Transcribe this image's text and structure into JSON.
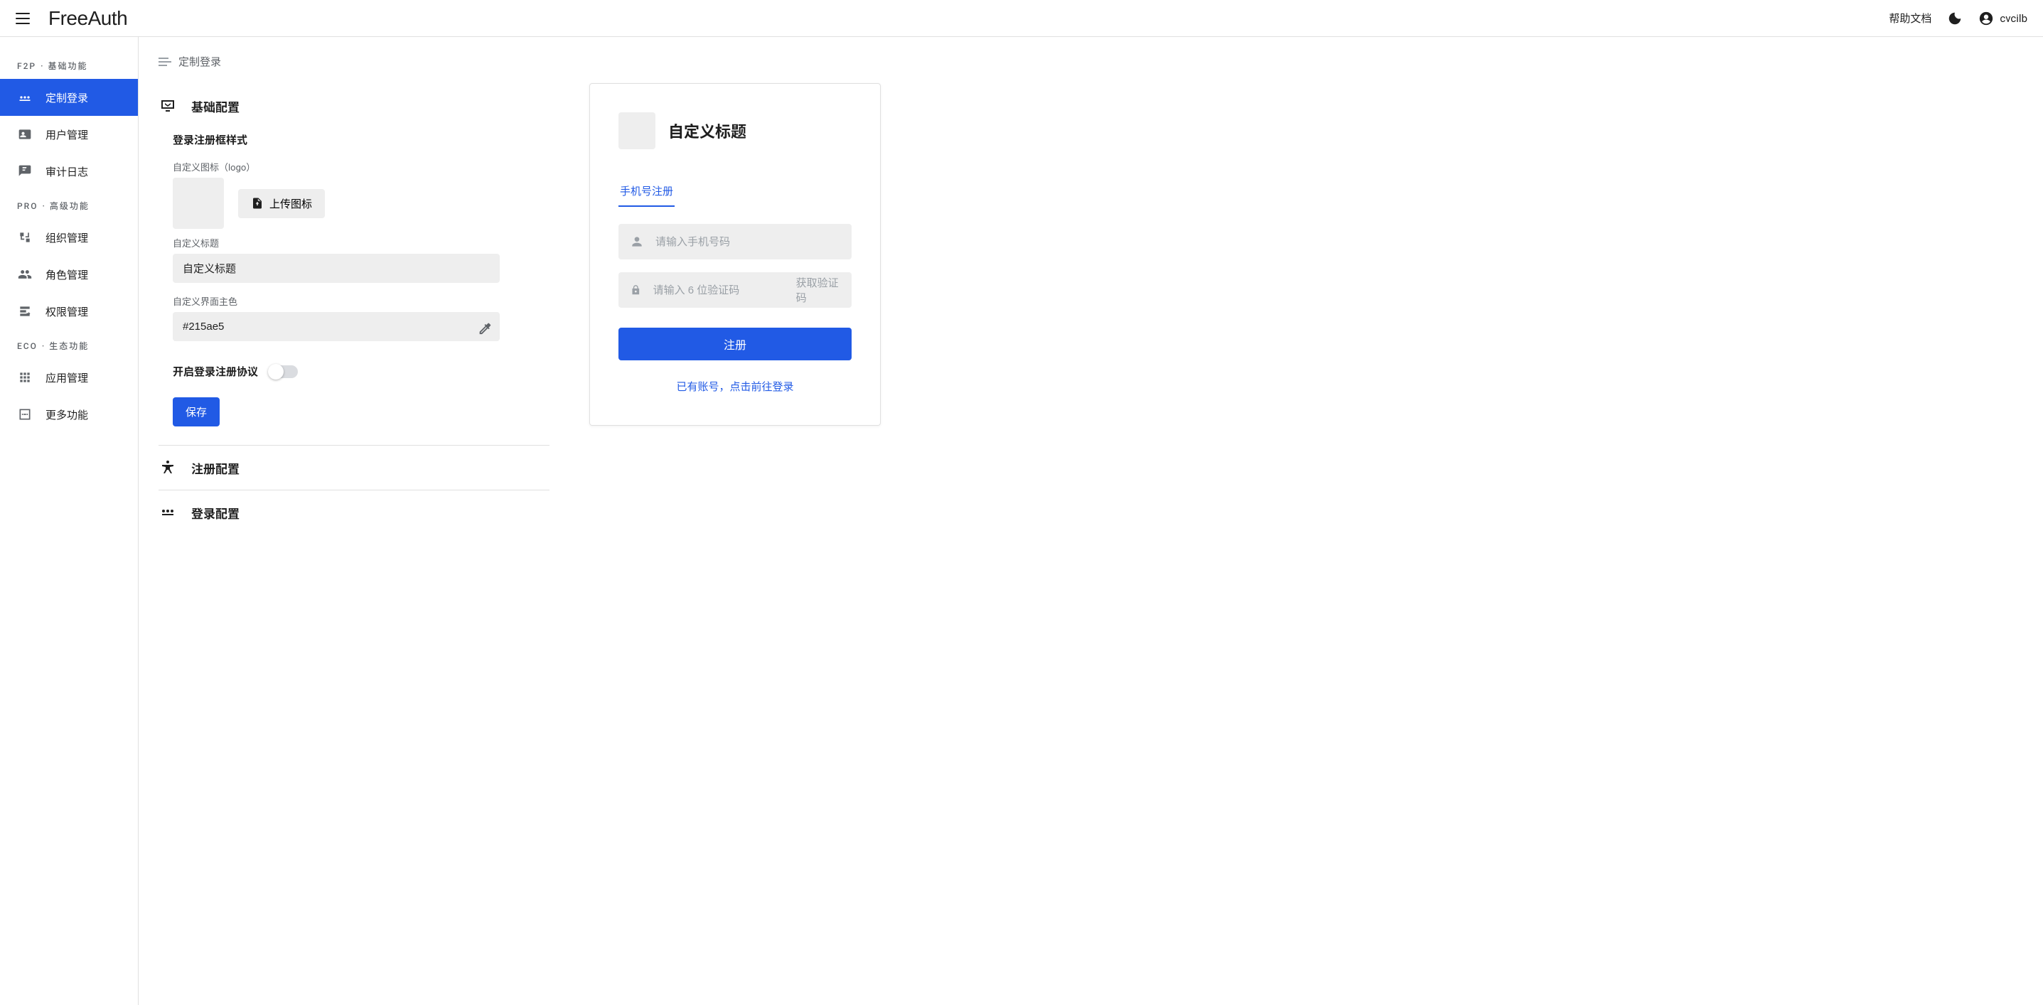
{
  "topbar": {
    "brand": "FreeAuth",
    "help_link": "帮助文档",
    "username": "cvcilb"
  },
  "sidebar": {
    "sections": [
      {
        "code": "F2P",
        "suffix": " · 基础功能",
        "items": [
          {
            "label": "定制登录",
            "icon": "password-icon",
            "active": true
          },
          {
            "label": "用户管理",
            "icon": "user-card-icon",
            "active": false
          },
          {
            "label": "审计日志",
            "icon": "chat-flag-icon",
            "active": false
          }
        ]
      },
      {
        "code": "PRO",
        "suffix": " · 高级功能",
        "items": [
          {
            "label": "组织管理",
            "icon": "org-tree-icon",
            "active": false
          },
          {
            "label": "角色管理",
            "icon": "people-icon",
            "active": false
          },
          {
            "label": "权限管理",
            "icon": "perm-icon",
            "active": false
          }
        ]
      },
      {
        "code": "ECO",
        "suffix": " · 生态功能",
        "items": [
          {
            "label": "应用管理",
            "icon": "grid-icon",
            "active": false
          },
          {
            "label": "更多功能",
            "icon": "more-box-icon",
            "active": false
          }
        ]
      }
    ]
  },
  "breadcrumb": {
    "current": "定制登录"
  },
  "config": {
    "basic": {
      "title": "基础配置",
      "style_heading": "登录注册框样式",
      "logo_label": "自定义图标（logo）",
      "upload_label": "上传图标",
      "title_field_label": "自定义标题",
      "title_value": "自定义标题",
      "color_label": "自定义界面主色",
      "color_value": "#215ae5",
      "agreement_label": "开启登录注册协议",
      "save_label": "保存"
    },
    "signup": {
      "title": "注册配置"
    },
    "signin": {
      "title": "登录配置"
    }
  },
  "preview": {
    "title": "自定义标题",
    "tab_label": "手机号注册",
    "phone_placeholder": "请输入手机号码",
    "code_placeholder": "请输入 6 位验证码",
    "get_code_label": "获取验证码",
    "submit_label": "注册",
    "alt_link": "已有账号，点击前往登录"
  }
}
